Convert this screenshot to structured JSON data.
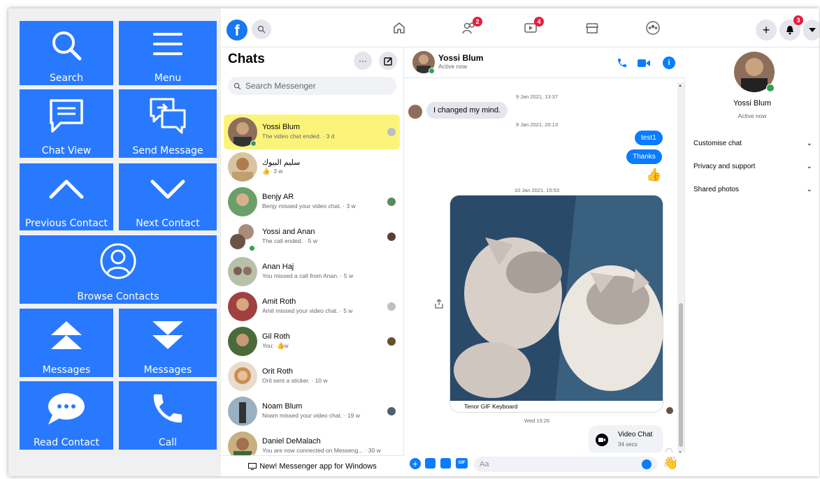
{
  "accessibility_panel": {
    "buttons": [
      {
        "label": "Search",
        "icon": "search-icon"
      },
      {
        "label": "Menu",
        "icon": "hamburger-icon"
      },
      {
        "label": "Chat View",
        "icon": "chat-bubble-icon"
      },
      {
        "label": "Send Message",
        "icon": "send-message-icon"
      },
      {
        "label": "Previous Contact",
        "icon": "chevron-up-icon"
      },
      {
        "label": "Next Contact",
        "icon": "chevron-down-icon"
      },
      {
        "label": "Browse Contacts",
        "icon": "user-circle-icon"
      },
      {
        "label": "Messages",
        "icon": "double-up-icon"
      },
      {
        "label": "Messages",
        "icon": "double-down-icon"
      },
      {
        "label": "Read Contact",
        "icon": "speech-dots-icon"
      },
      {
        "label": "Call",
        "icon": "phone-icon"
      }
    ],
    "color": "#2979ff"
  },
  "topnav": {
    "search_placeholder": "",
    "friends_badge": "2",
    "watch_badge": "4",
    "notif_badge": "3"
  },
  "chats": {
    "title": "Chats",
    "more_label": "···",
    "search_placeholder": "Search Messenger",
    "items": [
      {
        "name": "Yossi Blum",
        "msg": "The video chat ended. · 3 d"
      },
      {
        "name": "سليم البيوك",
        "msg": "· 3 w"
      },
      {
        "name": "Benjy AR",
        "msg": "Benjy missed your video chat. · 3 w"
      },
      {
        "name": "Yossi and Anan",
        "msg": "The call ended. · 5 w"
      },
      {
        "name": "Anan Haj",
        "msg": "You missed a call from Anan. · 5 w"
      },
      {
        "name": "Amit Roth",
        "msg": "Amit missed your video chat. · 5 w"
      },
      {
        "name": "Gil Roth",
        "msg": "You: · 8 w"
      },
      {
        "name": "Orit Roth",
        "msg": "Orit sent a sticker. · 10 w"
      },
      {
        "name": "Noam Blum",
        "msg": "Noam missed your video chat. · 19 w"
      },
      {
        "name": "Daniel DeMalach",
        "msg": "You are now connected on Messeng... · 30 w"
      }
    ],
    "banner": "New! Messenger app for Windows"
  },
  "conversation": {
    "name": "Yossi Blum",
    "status": "Active now",
    "messages": {
      "ts1": "9 Jan 2021, 13:37",
      "incoming1": "I changed my mind.",
      "ts2": "9 Jan 2021, 20:13",
      "out1": "test1",
      "out2": "Thanks",
      "ts3": "10 Jan 2021, 15:53",
      "gif_caption": "Tenor GIF Keyboard",
      "ts4": "Wed 15:26",
      "video_chat_title": "Video Chat",
      "video_chat_duration": "34 secs"
    },
    "composer_placeholder": "Aa"
  },
  "info_panel": {
    "name": "Yossi Blum",
    "status": "Active now",
    "sections": [
      "Customise chat",
      "Privacy and support",
      "Shared photos"
    ]
  },
  "colors": {
    "messenger_blue": "#0a7cff",
    "online_green": "#31a24c",
    "selected_row": "#fcf47a",
    "badge_red": "#e41e3f"
  }
}
